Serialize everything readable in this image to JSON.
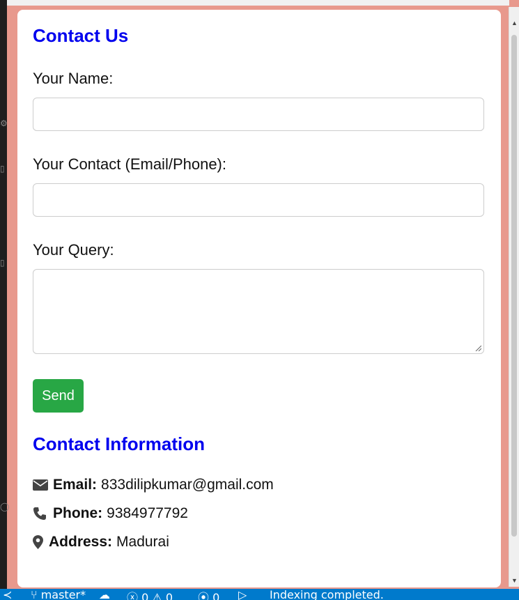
{
  "form": {
    "title": "Contact Us",
    "name_label": "Your Name:",
    "name_value": "",
    "contact_label": "Your Contact (Email/Phone):",
    "contact_value": "",
    "query_label": "Your Query:",
    "query_value": "",
    "send_label": "Send"
  },
  "info": {
    "title": "Contact Information",
    "email_label": "Email:",
    "email_value": "833dilipkumar@gmail.com",
    "phone_label": "Phone:",
    "phone_value": "9384977792",
    "address_label": "Address:",
    "address_value": "Madurai"
  },
  "status_bar": {
    "branch": "master*",
    "errors": "0",
    "warnings": "0",
    "ports": "0",
    "message": "Indexing completed."
  },
  "colors": {
    "heading": "#0000ee",
    "send_button": "#28a745",
    "page_background": "#e8998d",
    "status_bar": "#007acc"
  },
  "icons": [
    "envelope-icon",
    "phone-icon",
    "map-marker-icon",
    "source-control-icon",
    "cloud-sync-icon",
    "error-icon",
    "warning-icon",
    "broadcast-icon",
    "run-icon"
  ]
}
